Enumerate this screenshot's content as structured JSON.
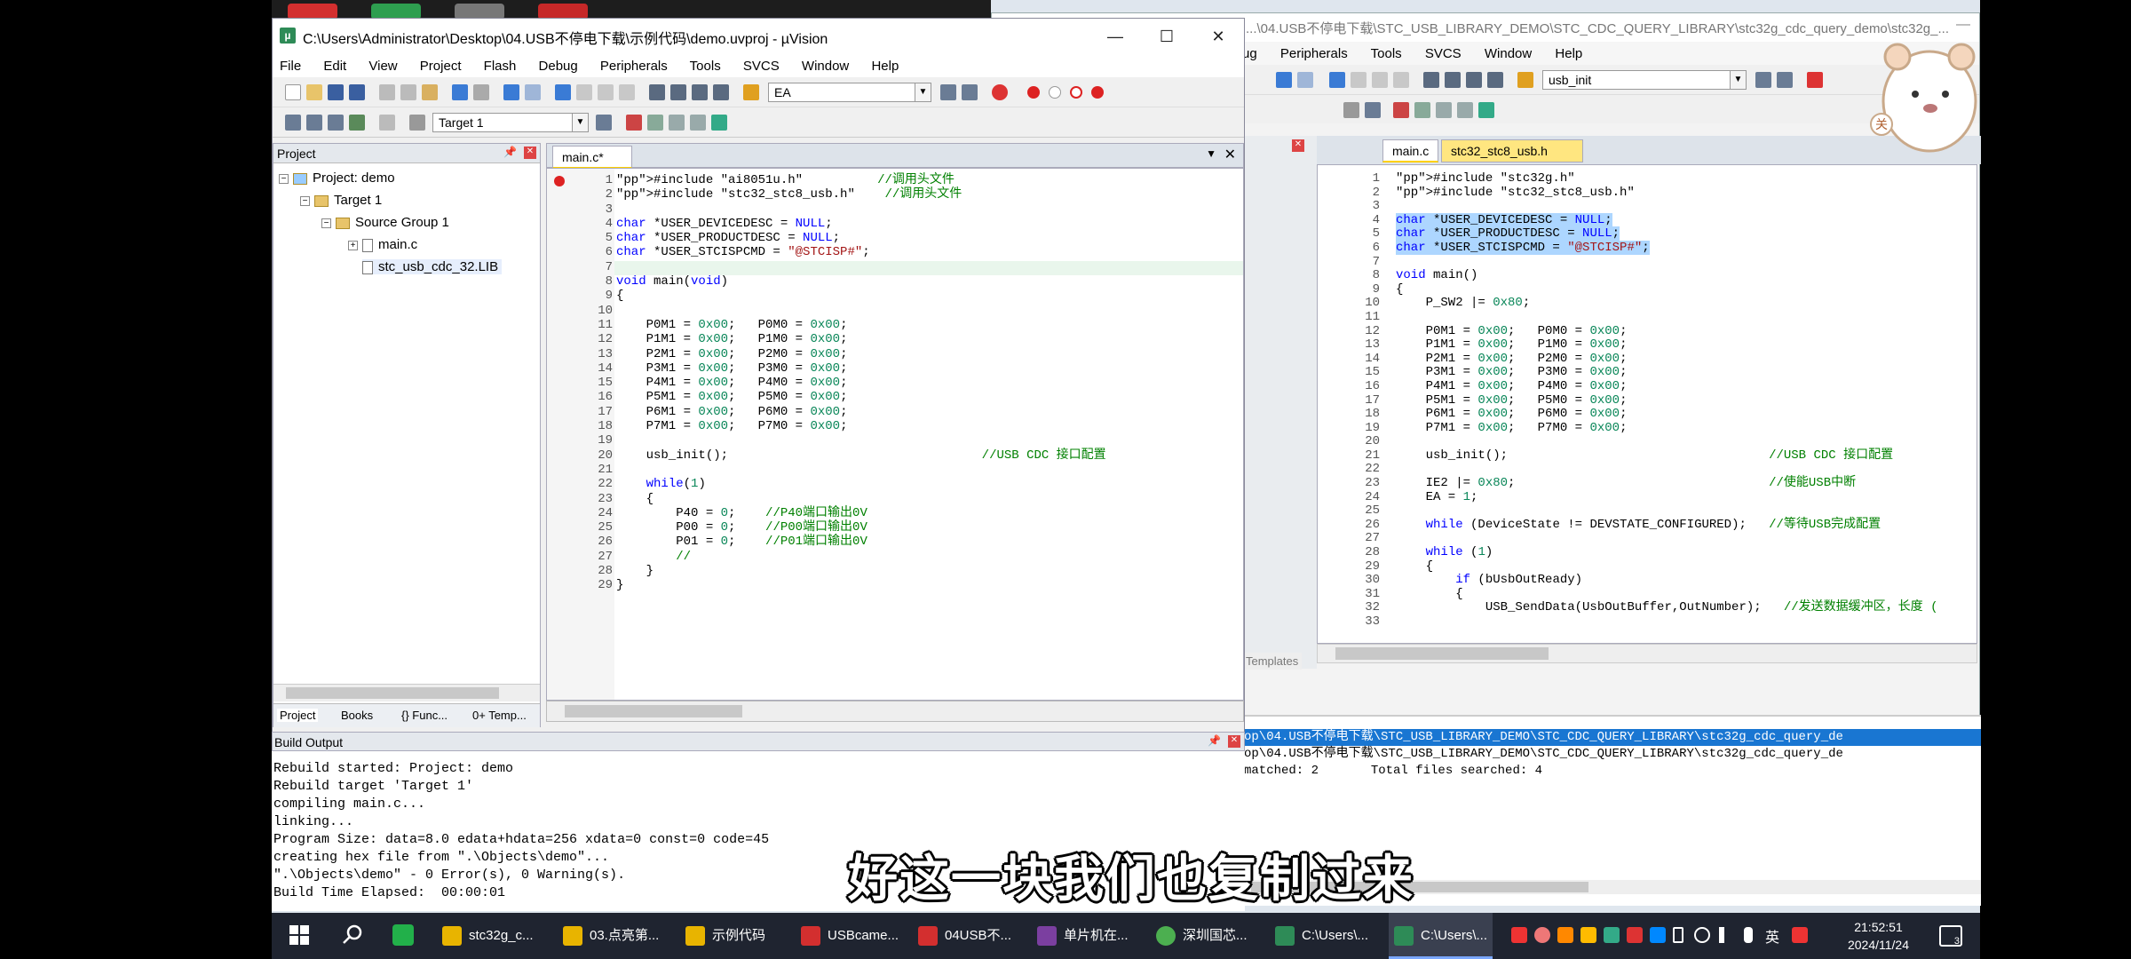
{
  "right_window": {
    "title": "...\\04.USB不停电下载\\STC_USB_LIBRARY_DEMO\\STC_CDC_QUERY_LIBRARY\\stc32g_cdc_query_demo\\stc32g_...",
    "menu": [
      "ug",
      "Peripherals",
      "Tools",
      "SVCS",
      "Window",
      "Help"
    ],
    "combo": "usb_init",
    "tabs": [
      "main.c",
      "stc32_stc8_usb.h"
    ],
    "templates_label": "Templates",
    "code": [
      {
        "n": "1",
        "t": "#include \"stc32g.h\""
      },
      {
        "n": "2",
        "t": "#include \"stc32_stc8_usb.h\""
      },
      {
        "n": "3",
        "t": ""
      },
      {
        "n": "4",
        "t": "char *USER_DEVICEDESC = NULL;",
        "sel": true
      },
      {
        "n": "5",
        "t": "char *USER_PRODUCTDESC = NULL;",
        "sel": true
      },
      {
        "n": "6",
        "t": "char *USER_STCISPCMD = \"@STCISP#\";",
        "sel": true
      },
      {
        "n": "7",
        "t": ""
      },
      {
        "n": "8",
        "t": "void main()"
      },
      {
        "n": "9",
        "t": "{"
      },
      {
        "n": "10",
        "t": "    P_SW2 |= 0x80;"
      },
      {
        "n": "11",
        "t": ""
      },
      {
        "n": "12",
        "t": "    P0M1 = 0x00;   P0M0 = 0x00;"
      },
      {
        "n": "13",
        "t": "    P1M1 = 0x00;   P1M0 = 0x00;"
      },
      {
        "n": "14",
        "t": "    P2M1 = 0x00;   P2M0 = 0x00;"
      },
      {
        "n": "15",
        "t": "    P3M1 = 0x00;   P3M0 = 0x00;"
      },
      {
        "n": "16",
        "t": "    P4M1 = 0x00;   P4M0 = 0x00;"
      },
      {
        "n": "17",
        "t": "    P5M1 = 0x00;   P5M0 = 0x00;"
      },
      {
        "n": "18",
        "t": "    P6M1 = 0x00;   P6M0 = 0x00;"
      },
      {
        "n": "19",
        "t": "    P7M1 = 0x00;   P7M0 = 0x00;"
      },
      {
        "n": "20",
        "t": ""
      },
      {
        "n": "21",
        "t": "    usb_init();                                   //USB CDC 接口配置"
      },
      {
        "n": "22",
        "t": ""
      },
      {
        "n": "23",
        "t": "    IE2 |= 0x80;                                  //使能USB中断"
      },
      {
        "n": "24",
        "t": "    EA = 1;"
      },
      {
        "n": "25",
        "t": ""
      },
      {
        "n": "26",
        "t": "    while (DeviceState != DEVSTATE_CONFIGURED);   //等待USB完成配置"
      },
      {
        "n": "27",
        "t": ""
      },
      {
        "n": "28",
        "t": "    while (1)"
      },
      {
        "n": "29",
        "t": "    {"
      },
      {
        "n": "30",
        "t": "        if (bUsbOutReady)"
      },
      {
        "n": "31",
        "t": "        {"
      },
      {
        "n": "32",
        "t": "            USB_SendData(UsbOutBuffer,OutNumber);   //发送数据缓冲区，长度 ("
      },
      {
        "n": "33",
        "t": ""
      }
    ],
    "find_lines": [
      "op\\04.USB不停电下载\\STC_USB_LIBRARY_DEMO\\STC_CDC_QUERY_LIBRARY\\stc32g_cdc_query_de",
      "op\\04.USB不停电下载\\STC_USB_LIBRARY_DEMO\\STC_CDC_QUERY_LIBRARY\\stc32g_cdc_query_de",
      "matched: 2       Total files searched: 4"
    ]
  },
  "main_window": {
    "title": "C:\\Users\\Administrator\\Desktop\\04.USB不停电下载\\示例代码\\demo.uvproj - µVision",
    "app_icon": "µ",
    "minimize": "—",
    "maximize": "☐",
    "close": "✕",
    "menu": [
      "File",
      "Edit",
      "View",
      "Project",
      "Flash",
      "Debug",
      "Peripherals",
      "Tools",
      "SVCS",
      "Window",
      "Help"
    ],
    "search_combo": "EA",
    "target_combo": "Target 1",
    "project_panel": {
      "header": "Project",
      "tree": [
        {
          "label": "Project: demo",
          "indent": 0,
          "icon": "project"
        },
        {
          "label": "Target 1",
          "indent": 1,
          "icon": "folder"
        },
        {
          "label": "Source Group 1",
          "indent": 2,
          "icon": "folder"
        },
        {
          "label": "main.c",
          "indent": 3,
          "icon": "doc"
        },
        {
          "label": "stc_usb_cdc_32.LIB",
          "indent": 3,
          "icon": "doc"
        }
      ],
      "tabs": [
        "Project",
        "Books",
        "{} Func...",
        "0+ Temp..."
      ]
    },
    "editor": {
      "tab": "main.c*",
      "code": [
        {
          "n": "1",
          "t": "#include \"ai8051u.h\"          //调用头文件"
        },
        {
          "n": "2",
          "t": "#include \"stc32_stc8_usb.h\"    //调用头文件"
        },
        {
          "n": "3",
          "t": ""
        },
        {
          "n": "4",
          "t": "char *USER_DEVICEDESC = NULL;"
        },
        {
          "n": "5",
          "t": "char *USER_PRODUCTDESC = NULL;"
        },
        {
          "n": "6",
          "t": "char *USER_STCISPCMD = \"@STCISP#\";"
        },
        {
          "n": "7",
          "t": ""
        },
        {
          "n": "8",
          "t": "void main(void)"
        },
        {
          "n": "9",
          "t": "{"
        },
        {
          "n": "10",
          "t": ""
        },
        {
          "n": "11",
          "t": "    P0M1 = 0x00;   P0M0 = 0x00;"
        },
        {
          "n": "12",
          "t": "    P1M1 = 0x00;   P1M0 = 0x00;"
        },
        {
          "n": "13",
          "t": "    P2M1 = 0x00;   P2M0 = 0x00;"
        },
        {
          "n": "14",
          "t": "    P3M1 = 0x00;   P3M0 = 0x00;"
        },
        {
          "n": "15",
          "t": "    P4M1 = 0x00;   P4M0 = 0x00;"
        },
        {
          "n": "16",
          "t": "    P5M1 = 0x00;   P5M0 = 0x00;"
        },
        {
          "n": "17",
          "t": "    P6M1 = 0x00;   P6M0 = 0x00;"
        },
        {
          "n": "18",
          "t": "    P7M1 = 0x00;   P7M0 = 0x00;"
        },
        {
          "n": "19",
          "t": ""
        },
        {
          "n": "20",
          "t": "    usb_init();                                  //USB CDC 接口配置"
        },
        {
          "n": "21",
          "t": ""
        },
        {
          "n": "22",
          "t": "    while(1)"
        },
        {
          "n": "23",
          "t": "    {"
        },
        {
          "n": "24",
          "t": "        P40 = 0;    //P40端口输出0V"
        },
        {
          "n": "25",
          "t": "        P00 = 0;    //P00端口输出0V"
        },
        {
          "n": "26",
          "t": "        P01 = 0;    //P01端口输出0V"
        },
        {
          "n": "27",
          "t": "        //"
        },
        {
          "n": "28",
          "t": "    }"
        },
        {
          "n": "29",
          "t": "}"
        }
      ]
    }
  },
  "build_output": {
    "header": "Build Output",
    "lines": [
      "Rebuild started: Project: demo",
      "Rebuild target 'Target 1'",
      "compiling main.c...",
      "linking...",
      "Program Size: data=8.0 edata+hdata=256 xdata=0 const=0 code=45",
      "creating hex file from \".\\Objects\\demo\"...",
      "\".\\Objects\\demo\" - 0 Error(s), 0 Warning(s).",
      "Build Time Elapsed:  00:00:01"
    ]
  },
  "subtitle": "好这一块我们也复制过来",
  "taskbar": {
    "items": [
      {
        "label": "stc32g_c...",
        "color": "#e8b400"
      },
      {
        "label": "03.点亮第...",
        "color": "#e8b400"
      },
      {
        "label": "示例代码",
        "color": "#e8b400"
      },
      {
        "label": "USBcame...",
        "color": "#d32f2f"
      },
      {
        "label": "04USB不...",
        "color": "#d32f2f"
      },
      {
        "label": "单片机在...",
        "color": "#7b3fa0"
      },
      {
        "label": "深圳国芯...",
        "color": "#4caf50"
      },
      {
        "label": "C:\\Users\\...",
        "color": "#2e8b57"
      },
      {
        "label": "C:\\Users\\...",
        "color": "#2e8b57",
        "active": true
      }
    ],
    "ime": "英",
    "time": "21:52:51",
    "date": "2024/11/24",
    "notif_count": "3"
  },
  "sticker_text": "关"
}
